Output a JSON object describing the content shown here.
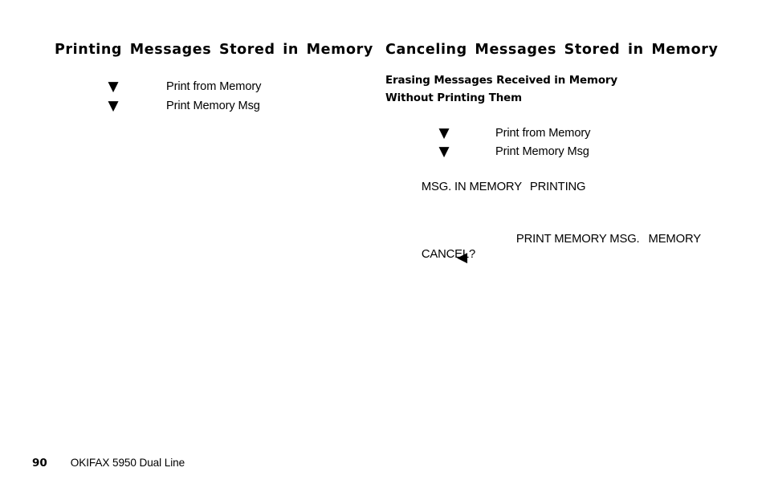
{
  "page": {
    "background_color": "#ffffff",
    "text_color": "#000000"
  },
  "left_column": {
    "heading": "Printing Messages Stored in Memory",
    "steps": [
      {
        "marker": "down-triangle",
        "marker_glyph": "▼",
        "label": "Print from Memory"
      },
      {
        "marker": "down-triangle",
        "marker_glyph": "▼",
        "label": "Print Memory Msg"
      }
    ]
  },
  "right_column": {
    "heading": "Canceling Messages Stored in Memory",
    "subheading": "Erasing Messages Received in Memory Without Printing Them",
    "steps": [
      {
        "marker": "down-triangle",
        "marker_glyph": "▼",
        "label": "Print from Memory"
      },
      {
        "marker": "down-triangle",
        "marker_glyph": "▼",
        "label": "Print Memory Msg"
      }
    ],
    "display_lines": [
      {
        "segment_1": "MSG. IN MEMORY",
        "segment_2": "PRINTING"
      },
      {
        "segment_1": "PRINT MEMORY MSG.",
        "segment_2": "MEMORY"
      },
      {
        "segment_1": "CANCEL?",
        "segment_2": ""
      }
    ],
    "cancel_marker": {
      "marker": "left-triangle",
      "marker_glyph": "◀"
    }
  },
  "footer": {
    "page_number": "90",
    "model": "OKIFAX 5950 Dual Line"
  }
}
